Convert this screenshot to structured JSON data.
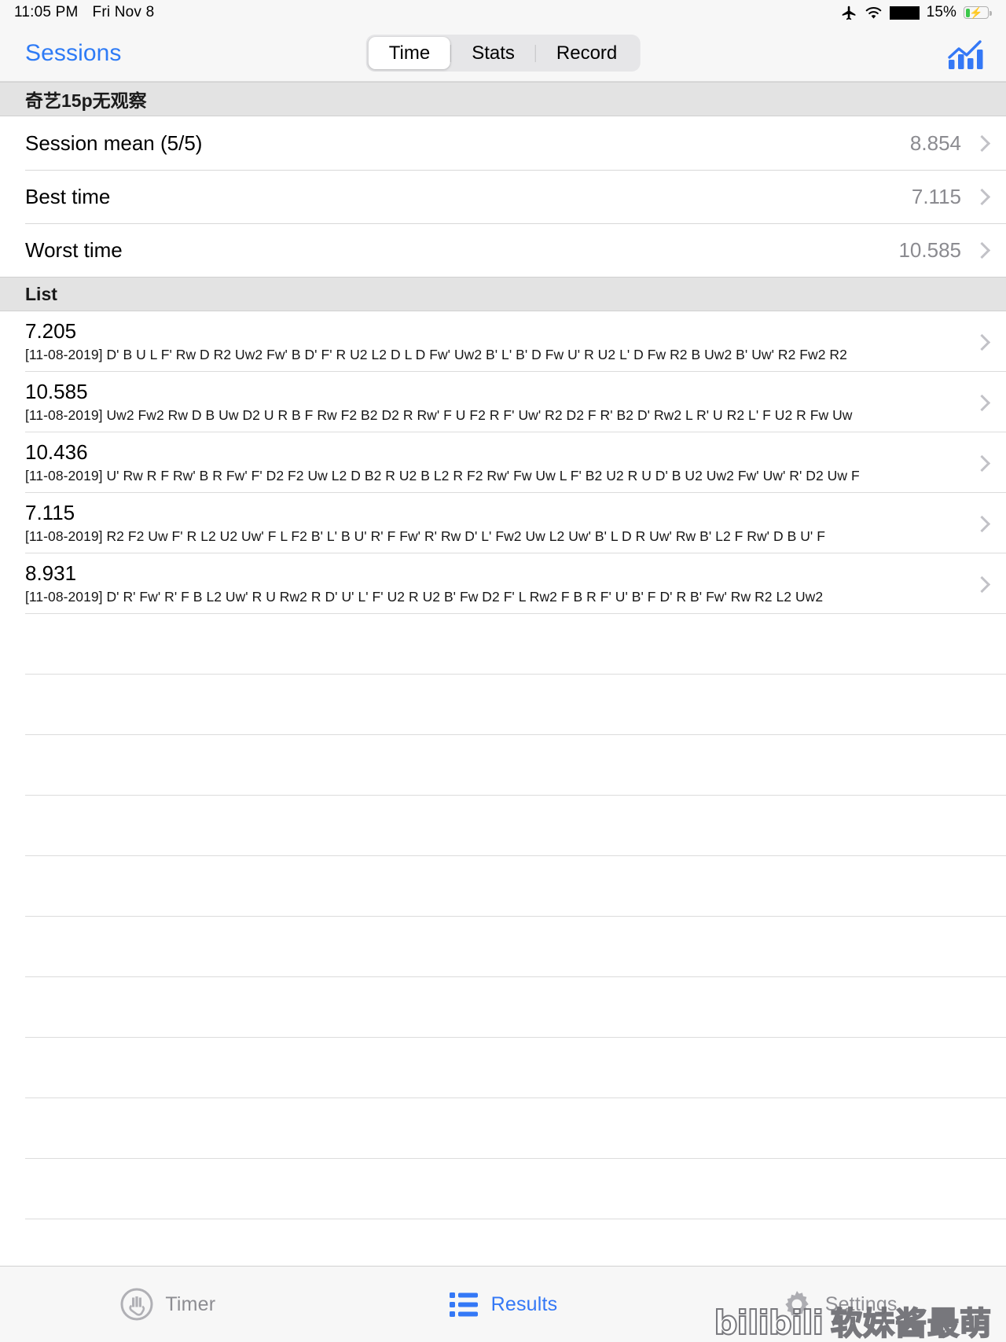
{
  "status_bar": {
    "time": "11:05 PM",
    "date": "Fri Nov 8",
    "airplane_icon": "airplane-icon",
    "wifi_icon": "wifi-icon",
    "redaction": "",
    "battery_percent": "15%",
    "battery_charging": true
  },
  "nav": {
    "back_label": "Sessions",
    "chart_icon": "bar-chart-icon",
    "segments": [
      {
        "label": "Time",
        "active": true
      },
      {
        "label": "Stats",
        "active": false
      },
      {
        "label": "Record",
        "active": false
      }
    ]
  },
  "session": {
    "header": "奇艺15p无观察",
    "summary": [
      {
        "label": "Session mean (5/5)",
        "value": "8.854"
      },
      {
        "label": "Best time",
        "value": "7.115"
      },
      {
        "label": "Worst time",
        "value": "10.585"
      }
    ]
  },
  "list": {
    "header": "List",
    "rows": [
      {
        "time": "7.205",
        "scramble": "[11-08-2019] D' B U L F' Rw D R2 Uw2 Fw' B D' F' R U2 L2 D L D Fw' Uw2 B' L' B' D Fw U' R U2 L' D Fw R2 B Uw2 B' Uw' R2 Fw2 R2"
      },
      {
        "time": "10.585",
        "scramble": "[11-08-2019] Uw2 Fw2 Rw D B Uw D2 U R B F Rw F2 B2 D2 R Rw' F U F2 R F' Uw' R2 D2 F R' B2 D' Rw2 L R' U R2 L' F U2 R Fw Uw"
      },
      {
        "time": "10.436",
        "scramble": "[11-08-2019] U' Rw R F Rw' B R Fw' F' D2 F2 Uw L2 D B2 R U2 B L2 R F2 Rw' Fw Uw L F' B2 U2 R U D' B U2 Uw2 Fw' Uw' R' D2 Uw F"
      },
      {
        "time": "7.115",
        "scramble": "[11-08-2019] R2 F2 Uw F' R L2 U2 Uw' F L F2 B' L' B U' R' F Fw' R' Rw D' L' Fw2 Uw L2 Uw' B' L D R Uw' Rw B' L2 F Rw' D B U' F"
      },
      {
        "time": "8.931",
        "scramble": "[11-08-2019] D' R' Fw' R' F B L2 Uw' R U Rw2 R D' U' L' F' U2 R U2 B' Fw D2 F' L Rw2 F B R F' U' B' F D' R B' Fw' Rw R2 L2 Uw2"
      }
    ],
    "empty_row_count": 12
  },
  "tabbar": {
    "tabs": [
      {
        "label": "Timer",
        "icon": "hand-timer-icon",
        "active": false
      },
      {
        "label": "Results",
        "icon": "list-bullets-icon",
        "active": true
      },
      {
        "label": "Settings",
        "icon": "gear-icon",
        "active": false
      }
    ]
  },
  "watermark": {
    "logo": "bilibili",
    "text": "软妹酱最萌"
  },
  "colors": {
    "accent": "#3478f6",
    "nav_link": "#2e7bf6",
    "secondary_text": "#8b8b90",
    "section_bg": "#e3e3e3",
    "battery_green": "#3cc84b"
  }
}
